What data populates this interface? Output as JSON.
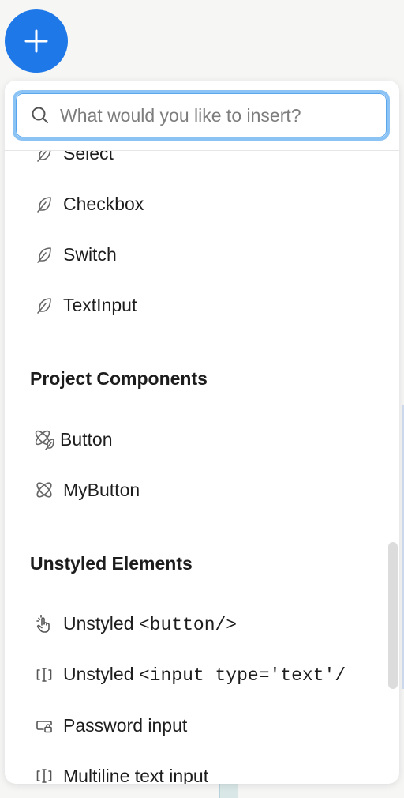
{
  "search": {
    "placeholder": "What would you like to insert?",
    "value": ""
  },
  "partial_items": {
    "select": "Select",
    "multiline": "Multiline text input"
  },
  "library_items": [
    "Checkbox",
    "Switch",
    "TextInput"
  ],
  "sections": {
    "project": {
      "title": "Project Components",
      "items": [
        "Button",
        "MyButton"
      ]
    },
    "unstyled": {
      "title": "Unstyled Elements",
      "prefix": "Unstyled",
      "button_code": "<button/>",
      "input_code": "<input type='text'/",
      "password": "Password input"
    }
  },
  "colors": {
    "fab": "#1e78e8",
    "search_focus": "#8cc3f5",
    "background": "#f6f6f5"
  },
  "icons": {
    "fab": "plus-icon",
    "search": "search-icon",
    "library": "feather-icon",
    "component": "atom-icon",
    "button": "hand-pointer-icon",
    "input": "text-cursor-icon",
    "password": "lock-input-icon",
    "multiline": "multiline-cursor-icon"
  }
}
